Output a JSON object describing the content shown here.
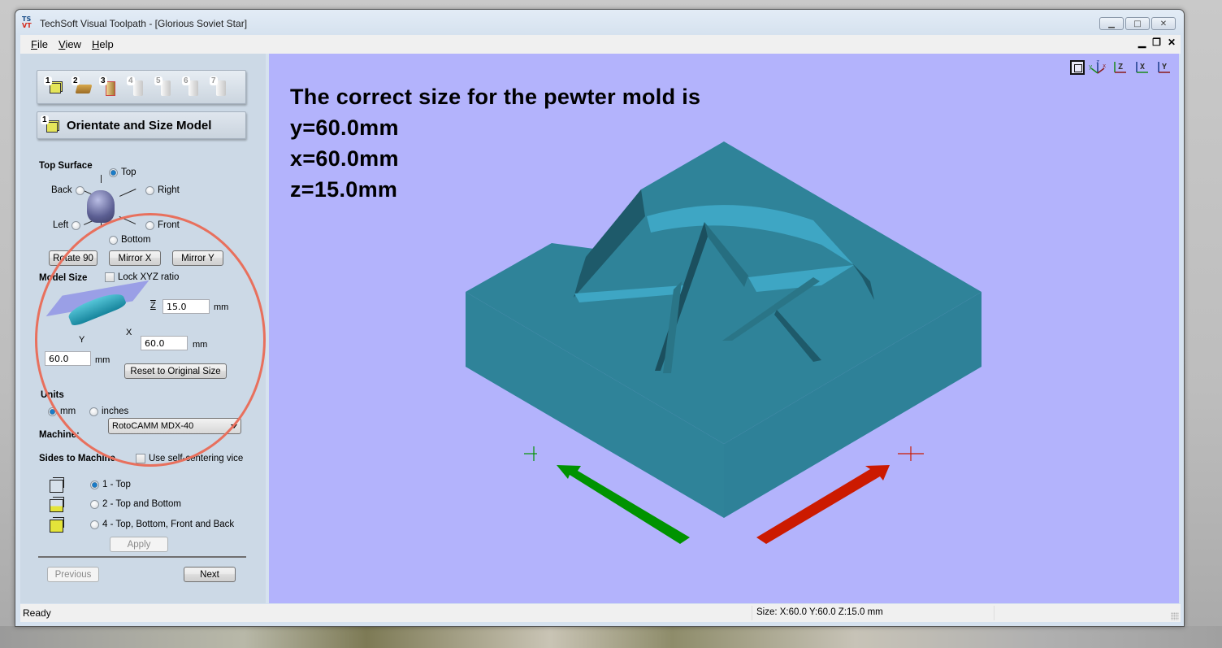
{
  "window": {
    "title": "TechSoft Visual Toolpath - [Glorious Soviet Star]",
    "app_icon": "techsoft-vt-logo",
    "controls": [
      "minimize",
      "maximize",
      "close"
    ]
  },
  "menubar": {
    "items": [
      {
        "label": "File",
        "accel": "F"
      },
      {
        "label": "View",
        "accel": "V"
      },
      {
        "label": "Help",
        "accel": "H"
      }
    ],
    "mdi_controls": [
      "minimize",
      "restore",
      "close"
    ]
  },
  "sidebar": {
    "step_toolbar": {
      "steps": [
        {
          "number": "1",
          "icon": "orientate-cube-icon",
          "enabled": true
        },
        {
          "number": "2",
          "icon": "material-block-icon",
          "enabled": true
        },
        {
          "number": "3",
          "icon": "toolpath-slab-icon",
          "enabled": true
        },
        {
          "number": "4",
          "icon": "step-4-icon",
          "enabled": false
        },
        {
          "number": "5",
          "icon": "step-5-icon",
          "enabled": false
        },
        {
          "number": "6",
          "icon": "preview-magnify-icon",
          "enabled": false
        },
        {
          "number": "7",
          "icon": "output-icon",
          "enabled": false
        }
      ]
    },
    "step_header": {
      "number": "1",
      "title": "Orientate and Size Model"
    },
    "top_surface": {
      "label": "Top Surface",
      "options": [
        {
          "label": "Top",
          "checked": true
        },
        {
          "label": "Back",
          "checked": false
        },
        {
          "label": "Right",
          "checked": false
        },
        {
          "label": "Left",
          "checked": false
        },
        {
          "label": "Front",
          "checked": false
        },
        {
          "label": "Bottom",
          "checked": false
        }
      ]
    },
    "buttons": {
      "rotate": "Rotate 90",
      "mirror_x": "Mirror X",
      "mirror_y": "Mirror Y",
      "reset": "Reset to Original Size",
      "apply": "Apply",
      "previous": "Previous",
      "next": "Next"
    },
    "model_size": {
      "label": "Model Size",
      "lock_label": "Lock XYZ ratio",
      "lock_checked": false,
      "z_value": "15.0",
      "x_value": "60.0",
      "y_value": "60.0",
      "unit": "mm",
      "axis_labels": {
        "z": "Z",
        "x": "X",
        "y": "Y"
      }
    },
    "units": {
      "label": "Units",
      "options": [
        {
          "label": "mm",
          "checked": true
        },
        {
          "label": "inches",
          "checked": false
        }
      ]
    },
    "machine": {
      "label": "Machine:",
      "value": "RotoCAMM MDX-40"
    },
    "sides": {
      "label": "Sides to Machine",
      "vice_label": "Use self-centering vice",
      "vice_checked": false,
      "options": [
        {
          "label": "1 - Top",
          "checked": true
        },
        {
          "label": "2 - Top and Bottom",
          "checked": false
        },
        {
          "label": "4 - Top, Bottom, Front and Back",
          "checked": false
        }
      ]
    }
  },
  "viewport": {
    "annotation_lines": [
      "The correct size for the pewter mold is",
      "y=60.0mm",
      "x=60.0mm",
      "z=15.0mm"
    ],
    "view_icons": [
      {
        "name": "zoom-fit-icon"
      },
      {
        "name": "iso-view-icon",
        "axes": "y z x"
      },
      {
        "name": "view-z-icon",
        "label": "Z"
      },
      {
        "name": "view-x-icon",
        "label": "X"
      },
      {
        "name": "view-y-icon",
        "label": "Y"
      }
    ],
    "colors": {
      "background": "#b3b3fc",
      "model": "#2f8399",
      "model_highlight": "#3ea6c4",
      "model_shadow": "#1b4f5e",
      "y_arrow": "#009300",
      "x_arrow": "#cc1a00"
    }
  },
  "statusbar": {
    "status": "Ready",
    "size": "Size: X:60.0 Y:60.0 Z:15.0 mm"
  }
}
